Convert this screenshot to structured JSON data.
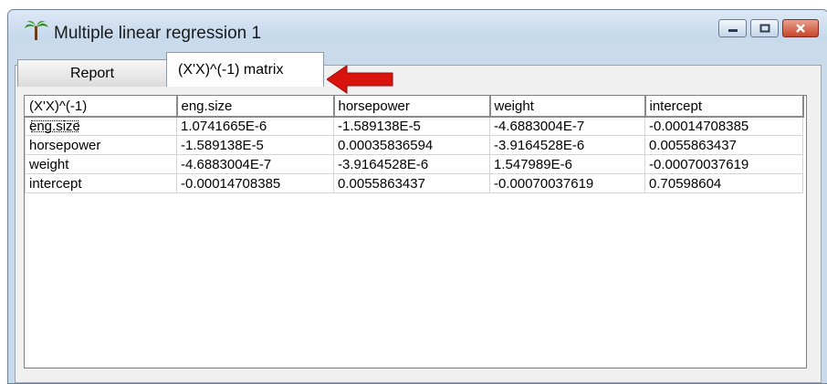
{
  "window": {
    "title": "Multiple linear regression 1",
    "icon": "palm-tree-icon",
    "controls": [
      "minimize",
      "maximize",
      "close"
    ]
  },
  "tabs": [
    {
      "label": "Report",
      "active": false
    },
    {
      "label": "(X'X)^(-1) matrix",
      "active": true
    }
  ],
  "table": {
    "corner": "(X'X)^(-1)",
    "columns": [
      "eng.size",
      "horsepower",
      "weight",
      "intercept"
    ],
    "rows": [
      {
        "label": "eng.size",
        "cells": [
          "1.0741665E-6",
          "-1.589138E-5",
          "-4.6883004E-7",
          "-0.00014708385"
        ]
      },
      {
        "label": "horsepower",
        "cells": [
          "-1.589138E-5",
          "0.00035836594",
          "-3.9164528E-6",
          "0.0055863437"
        ]
      },
      {
        "label": "weight",
        "cells": [
          "-4.6883004E-7",
          "-3.9164528E-6",
          "1.547989E-6",
          "-0.00070037619"
        ]
      },
      {
        "label": "intercept",
        "cells": [
          "-0.00014708385",
          "0.0055863437",
          "-0.00070037619",
          "0.70598604"
        ]
      }
    ]
  },
  "annotation": {
    "type": "arrow",
    "color": "#d9140f",
    "points_to": "tab-matrix"
  }
}
